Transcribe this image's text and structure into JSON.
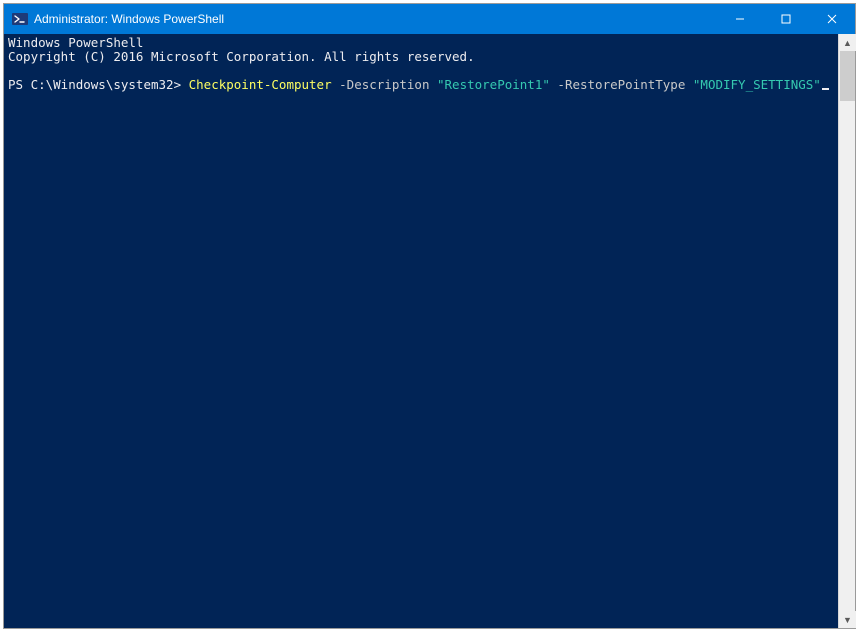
{
  "titlebar": {
    "icon_name": "powershell-icon",
    "title": "Administrator: Windows PowerShell",
    "buttons": {
      "minimize_label": "–",
      "maximize_label": "▢",
      "close_label": "✕"
    }
  },
  "console": {
    "banner_line1": "Windows PowerShell",
    "banner_line2": "Copyright (C) 2016 Microsoft Corporation. All rights reserved.",
    "prompt": "PS C:\\Windows\\system32> ",
    "cmd": {
      "cmdlet": "Checkpoint-Computer",
      "param1": "-Description",
      "arg1": "\"RestorePoint1\"",
      "param2": "-RestorePointType",
      "arg2": "\"MODIFY_SETTINGS\""
    }
  },
  "scrollbar": {
    "up_glyph": "▲",
    "down_glyph": "▼"
  }
}
